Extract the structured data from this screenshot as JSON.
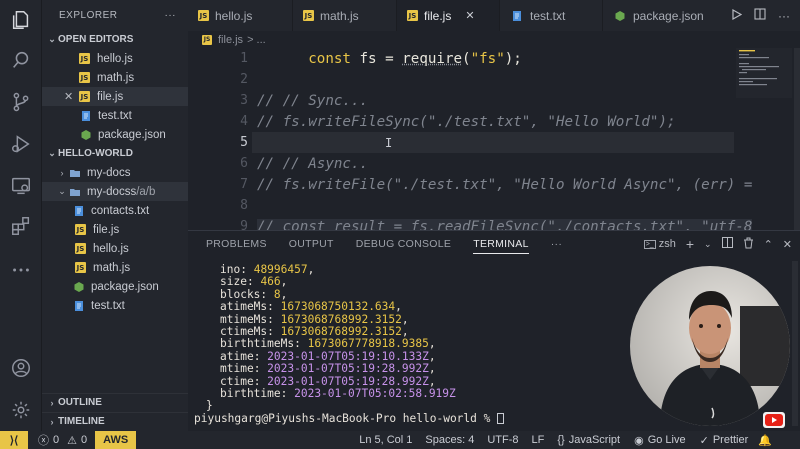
{
  "explorer": {
    "title": "EXPLORER",
    "more": "···",
    "open_editors_label": "OPEN EDITORS",
    "open_editors": [
      {
        "name": "hello.js",
        "type": "js"
      },
      {
        "name": "math.js",
        "type": "js"
      },
      {
        "name": "file.js",
        "type": "js"
      },
      {
        "name": "test.txt",
        "type": "txt"
      },
      {
        "name": "package.json",
        "type": "json"
      }
    ],
    "workspace_label": "HELLO-WORLD",
    "tree": [
      {
        "name": "my-docs",
        "type": "folder"
      },
      {
        "name": "my-docss",
        "path": "/a/b",
        "type": "folder"
      },
      {
        "name": "contacts.txt",
        "type": "txt"
      },
      {
        "name": "file.js",
        "type": "js"
      },
      {
        "name": "hello.js",
        "type": "js"
      },
      {
        "name": "math.js",
        "type": "js"
      },
      {
        "name": "package.json",
        "type": "json"
      },
      {
        "name": "test.txt",
        "type": "txt"
      }
    ],
    "outline_label": "OUTLINE",
    "timeline_label": "TIMELINE"
  },
  "tabs": [
    {
      "label": "hello.js",
      "type": "js"
    },
    {
      "label": "math.js",
      "type": "js"
    },
    {
      "label": "file.js",
      "type": "js"
    },
    {
      "label": "test.txt",
      "type": "txt"
    },
    {
      "label": "package.json",
      "type": "json"
    }
  ],
  "breadcrumb": {
    "file": "file.js",
    "rest": "> ..."
  },
  "editor": {
    "lines": [
      {
        "n": "1"
      },
      {
        "n": "2"
      },
      {
        "n": "3"
      },
      {
        "n": "4"
      },
      {
        "n": "5"
      },
      {
        "n": "6"
      },
      {
        "n": "7"
      },
      {
        "n": "8"
      },
      {
        "n": "9"
      }
    ],
    "code": {
      "l1_kw": "const",
      "l1_var": "fs",
      "l1_eq": "=",
      "l1_fn": "require",
      "l1_open": "(",
      "l1_str": "\"fs\"",
      "l1_close": ");",
      "l3": "// // Sync...",
      "l4": "// fs.writeFileSync(\"./test.txt\", \"Hello World\");",
      "l6": "// // Async..",
      "l7": "// fs.writeFile(\"./test.txt\", \"Hello World Async\", (err) =",
      "l9": "// const result = fs.readFileSync(\"./contacts.txt\", \"utf-8"
    }
  },
  "panel": {
    "tabs": [
      "PROBLEMS",
      "OUTPUT",
      "DEBUG CONSOLE",
      "TERMINAL",
      "···"
    ],
    "shell": "zsh",
    "terminal": [
      {
        "key": "ino",
        "val": "48996457",
        "kind": "num"
      },
      {
        "key": "size",
        "val": "466",
        "kind": "num"
      },
      {
        "key": "blocks",
        "val": "8",
        "kind": "num"
      },
      {
        "key": "atimeMs",
        "val": "1673068750132.634",
        "kind": "num"
      },
      {
        "key": "mtimeMs",
        "val": "1673068768992.3152",
        "kind": "num"
      },
      {
        "key": "ctimeMs",
        "val": "1673068768992.3152",
        "kind": "num"
      },
      {
        "key": "birthtimeMs",
        "val": "1673067778918.9385",
        "kind": "num"
      },
      {
        "key": "atime",
        "val": "2023-01-07T05:19:10.133Z",
        "kind": "date"
      },
      {
        "key": "mtime",
        "val": "2023-01-07T05:19:28.992Z",
        "kind": "date"
      },
      {
        "key": "ctime",
        "val": "2023-01-07T05:19:28.992Z",
        "kind": "date"
      },
      {
        "key": "birthtime",
        "val": "2023-01-07T05:02:58.919Z",
        "kind": "date",
        "last": true
      }
    ],
    "close_brace": "}",
    "prompt": "piyushgarg@Piyushs-MacBook-Pro hello-world % "
  },
  "status": {
    "errors": "0",
    "warnings": "0",
    "aws": "AWS",
    "position": "Ln 5, Col 1",
    "spaces": "Spaces: 4",
    "encoding": "UTF-8",
    "eol": "LF",
    "language": "JavaScript",
    "golive": "Go Live",
    "prettier": "Prettier"
  },
  "colors": {
    "accent": "#e8c547",
    "background": "#1f2229",
    "sidebar": "#23262d"
  }
}
